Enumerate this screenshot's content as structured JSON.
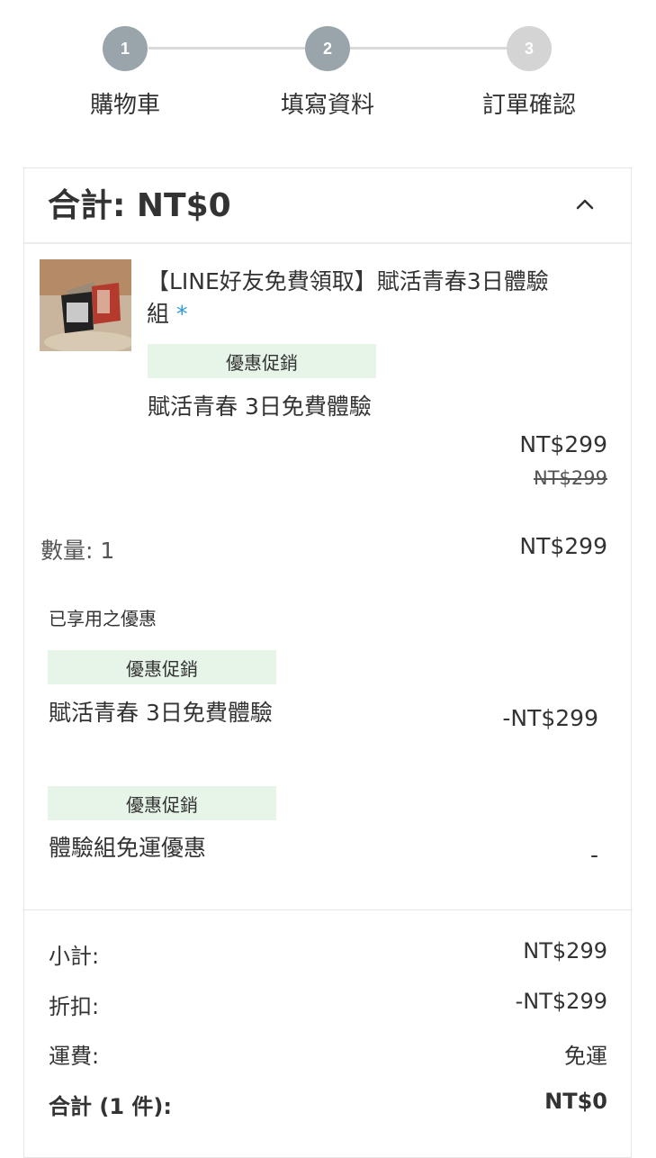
{
  "steps": [
    {
      "number": "1",
      "label": "購物車"
    },
    {
      "number": "2",
      "label": "填寫資料"
    },
    {
      "number": "3",
      "label": "訂單確認"
    }
  ],
  "summary": {
    "title": "合計: NT$0"
  },
  "product": {
    "name": "【LINE好友免費領取】賦活青春3日體驗組",
    "required_mark": "*",
    "promo_badge": "優惠促銷",
    "promo_name": "賦活青春 3日免費體驗",
    "price": "NT$299",
    "original_price": "NT$299",
    "quantity_label": "數量: 1",
    "line_total": "NT$299"
  },
  "applied_discounts": {
    "heading": "已享用之優惠",
    "items": [
      {
        "badge": "優惠促銷",
        "name": "賦活青春 3日免費體驗",
        "amount": "-NT$299"
      },
      {
        "badge": "優惠促銷",
        "name": "體驗組免運優惠",
        "amount": "-"
      }
    ]
  },
  "totals": {
    "subtotal_label": "小計:",
    "subtotal_value": "NT$299",
    "discount_label": "折扣:",
    "discount_value": "-NT$299",
    "shipping_label": "運費:",
    "shipping_value": "免運",
    "total_label": "合計 (1 件):",
    "total_value": "NT$0"
  },
  "colors": {
    "accent": "#2a9bd6",
    "badge_bg": "#e7f5e8",
    "step_active": "#9aa5ab",
    "step_inactive": "#d4d4d4"
  }
}
